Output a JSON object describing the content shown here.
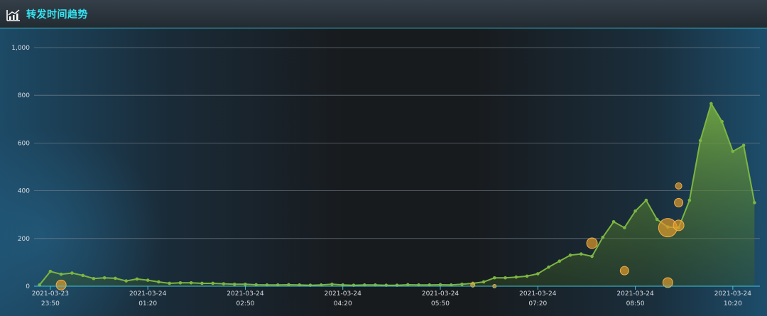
{
  "header": {
    "title": "转发时间趋势",
    "icon": "line-chart-icon",
    "accent_color": "#35e3f2"
  },
  "chart_data": {
    "type": "line",
    "title": "转发时间趋势",
    "ylim": [
      0,
      1000
    ],
    "y_ticks": [
      0,
      200,
      400,
      600,
      800,
      1000
    ],
    "y_tick_labels": [
      "0",
      "200",
      "400",
      "600",
      "800",
      "1,000"
    ],
    "x_tick_labels": [
      [
        "2021-03-23",
        "23:50"
      ],
      [
        "2021-03-24",
        "01:20"
      ],
      [
        "2021-03-24",
        "02:50"
      ],
      [
        "2021-03-24",
        "04:20"
      ],
      [
        "2021-03-24",
        "05:50"
      ],
      [
        "2021-03-24",
        "07:20"
      ],
      [
        "2021-03-24",
        "08:50"
      ],
      [
        "2021-03-24",
        "10:20"
      ]
    ],
    "x_tick_index": [
      1,
      10,
      19,
      28,
      37,
      46,
      55,
      64
    ],
    "grid": true,
    "line_color": "#7cb542",
    "bubble_color": "#e09a2a",
    "series": [
      {
        "values": [
          5,
          62,
          50,
          55,
          45,
          32,
          35,
          33,
          22,
          30,
          25,
          18,
          12,
          14,
          14,
          12,
          12,
          10,
          8,
          8,
          6,
          5,
          5,
          6,
          5,
          4,
          5,
          8,
          5,
          4,
          5,
          5,
          4,
          4,
          6,
          5,
          5,
          6,
          5,
          8,
          12,
          18,
          35,
          35,
          38,
          42,
          52,
          80,
          105,
          130,
          135,
          125,
          205,
          270,
          245,
          315,
          360,
          280,
          248,
          245,
          360,
          610,
          765,
          690,
          565,
          590,
          350
        ]
      }
    ],
    "bubbles": [
      {
        "x": 2,
        "y": 5,
        "size": 14
      },
      {
        "x": 40,
        "y": 5,
        "size": 6
      },
      {
        "x": 42,
        "y": 0,
        "size": 5
      },
      {
        "x": 51,
        "y": 180,
        "size": 15
      },
      {
        "x": 54,
        "y": 65,
        "size": 12
      },
      {
        "x": 58,
        "y": 245,
        "size": 26
      },
      {
        "x": 58,
        "y": 15,
        "size": 14
      },
      {
        "x": 59,
        "y": 255,
        "size": 15
      },
      {
        "x": 59,
        "y": 350,
        "size": 12
      },
      {
        "x": 59,
        "y": 420,
        "size": 9
      }
    ]
  }
}
